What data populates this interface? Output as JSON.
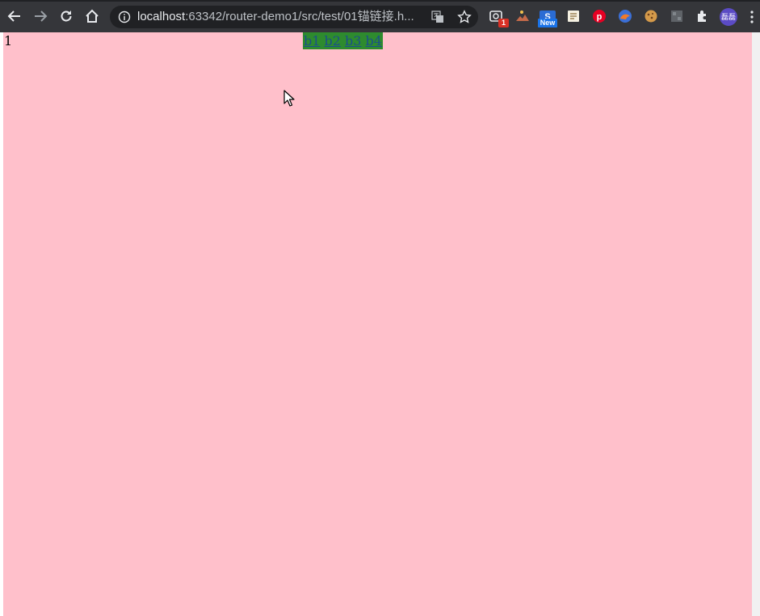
{
  "browser": {
    "url_host": "localhost",
    "url_path": ":63342/router-demo1/src/test/01锚链接.h...",
    "extension_badge_count": "1",
    "new_badge_label": "New",
    "avatar_text": "磊磊"
  },
  "page": {
    "background_color": "#ffc0cb",
    "content_text": "1",
    "nav_links": [
      {
        "label": "b1"
      },
      {
        "label": "b2"
      },
      {
        "label": "b3"
      },
      {
        "label": "b4"
      }
    ],
    "nav_background_color": "#2e8b2e"
  }
}
